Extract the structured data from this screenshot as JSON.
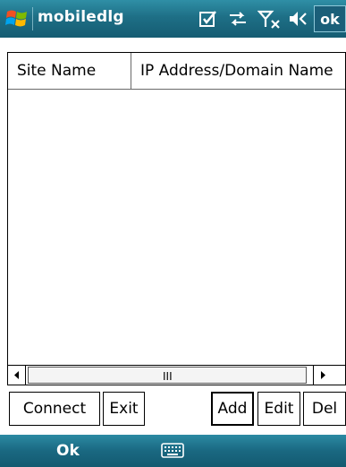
{
  "titlebar": {
    "title": "mobiledlg",
    "ok_label": "ok",
    "icons": [
      "windows-start-icon",
      "edit-checkbox-icon",
      "connectivity-icon",
      "no-signal-icon",
      "volume-icon"
    ]
  },
  "listview": {
    "columns": [
      "Site Name",
      "IP Address/Domain Name"
    ],
    "rows": []
  },
  "scrollbar": {
    "grip": "III"
  },
  "buttons": {
    "connect": "Connect",
    "exit": "Exit",
    "add": "Add",
    "edit": "Edit",
    "del": "Del"
  },
  "softbar": {
    "left": "Ok",
    "center_icon": "keyboard-icon"
  },
  "colors": {
    "bar_primary": "#1e6f86",
    "bar_light": "#2f8fa6"
  }
}
